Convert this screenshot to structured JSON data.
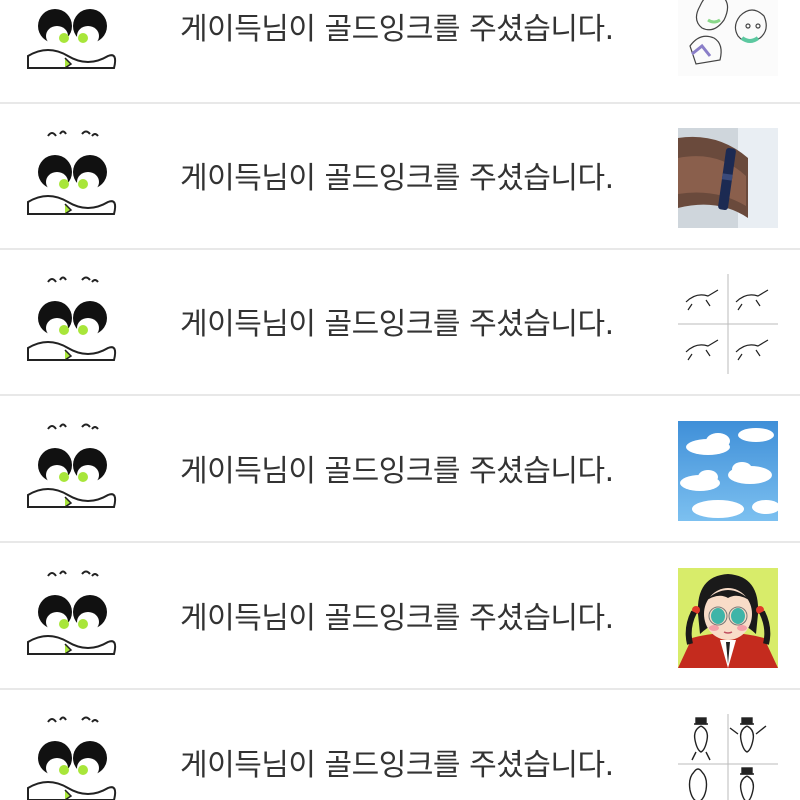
{
  "notifications": [
    {
      "avatar": "doodle-avatar",
      "message": "게이득님이 골드잉크를 주셨습니다.",
      "thumbnail": "sketch-drawing"
    },
    {
      "avatar": "doodle-avatar",
      "message": "게이득님이 골드잉크를 주셨습니다.",
      "thumbnail": "wristband-photo"
    },
    {
      "avatar": "doodle-avatar",
      "message": "게이득님이 골드잉크를 주셨습니다.",
      "thumbnail": "four-panel-doodle"
    },
    {
      "avatar": "doodle-avatar",
      "message": "게이득님이 골드잉크를 주셨습니다.",
      "thumbnail": "sky-clouds"
    },
    {
      "avatar": "doodle-avatar",
      "message": "게이득님이 골드잉크를 주셨습니다.",
      "thumbnail": "anime-girl-portrait"
    },
    {
      "avatar": "doodle-avatar",
      "message": "게이득님이 골드잉크를 주셨습니다.",
      "thumbnail": "stick-figure-panels"
    }
  ],
  "colors": {
    "text": "#333333",
    "divider": "#e8e8e8",
    "avatar_accent": "#a8e63a",
    "sky": "#5aa9e6"
  }
}
